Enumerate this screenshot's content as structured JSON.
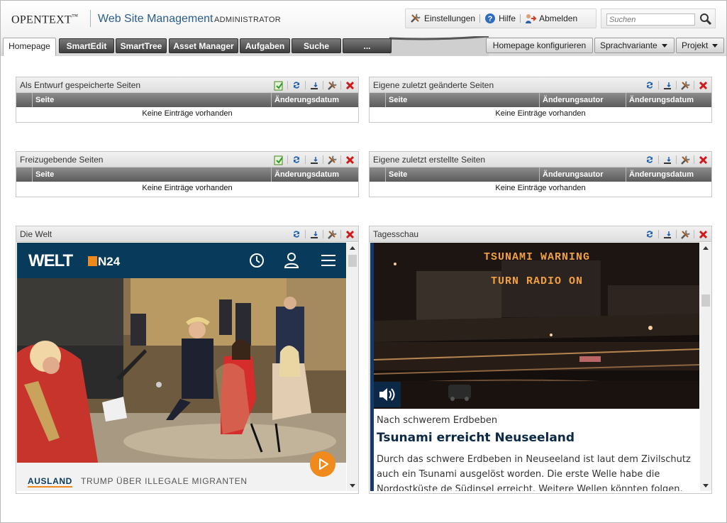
{
  "header": {
    "logo": "OPENTEXT",
    "logo_tm": "™",
    "product": "Web Site Management",
    "role": "ADMINISTRATOR",
    "settings_label": "Einstellungen",
    "help_label": "Hilfe",
    "logout_label": "Abmelden",
    "search_placeholder": "Suchen"
  },
  "tabs": {
    "items": [
      {
        "label": "Homepage"
      },
      {
        "label": "SmartEdit"
      },
      {
        "label": "SmartTree"
      },
      {
        "label": "Asset Manager"
      },
      {
        "label": "Aufgaben"
      },
      {
        "label": "Suche"
      },
      {
        "label": "..."
      }
    ],
    "configure_label": "Homepage konfigurieren",
    "language_label": "Sprachvariante",
    "project_label": "Projekt"
  },
  "panels": {
    "drafts": {
      "title": "Als Entwurf gespeicherte Seiten",
      "col_page": "Seite",
      "col_date": "Änderungsdatum",
      "empty": "Keine Einträge vorhanden"
    },
    "recent_changed": {
      "title": "Eigene zuletzt geänderte Seiten",
      "col_page": "Seite",
      "col_author": "Änderungsautor",
      "col_date": "Änderungsdatum",
      "empty": "Keine Einträge vorhanden"
    },
    "release": {
      "title": "Freizugebende Seiten",
      "col_page": "Seite",
      "col_date": "Änderungsdatum",
      "empty": "Keine Einträge vorhanden"
    },
    "recent_created": {
      "title": "Eigene zuletzt erstellte Seiten",
      "col_page": "Seite",
      "col_author": "Änderungsautor",
      "col_date": "Änderungsdatum",
      "empty": "Keine Einträge vorhanden"
    },
    "welt": {
      "title": "Die Welt",
      "brand": "WELT",
      "brand_sub": "N24",
      "category": "AUSLAND",
      "teaser": "TRUMP ÜBER ILLEGALE MIGRANTEN"
    },
    "tagesschau": {
      "title": "Tagesschau",
      "sign_line1": "TSUNAMI WARNING",
      "sign_line2": "TURN RADIO ON",
      "kicker": "Nach schwerem Erdbeben",
      "headline": "Tsunami erreicht Neuseeland",
      "text": "Durch das schwere Erdbeben in Neuseeland ist laut dem Zivilschutz auch ein Tsunami ausgelöst worden. Die erste Welle habe die Nordostküste de Südinsel erreicht. Weitere Wellen könnten folgen. Das Ausmaß der"
    }
  },
  "colors": {
    "accent": "#f18a1c",
    "welt_navy": "#083a5c",
    "tagesschau_blue": "#0b2946",
    "delete_red": "#d01818"
  }
}
